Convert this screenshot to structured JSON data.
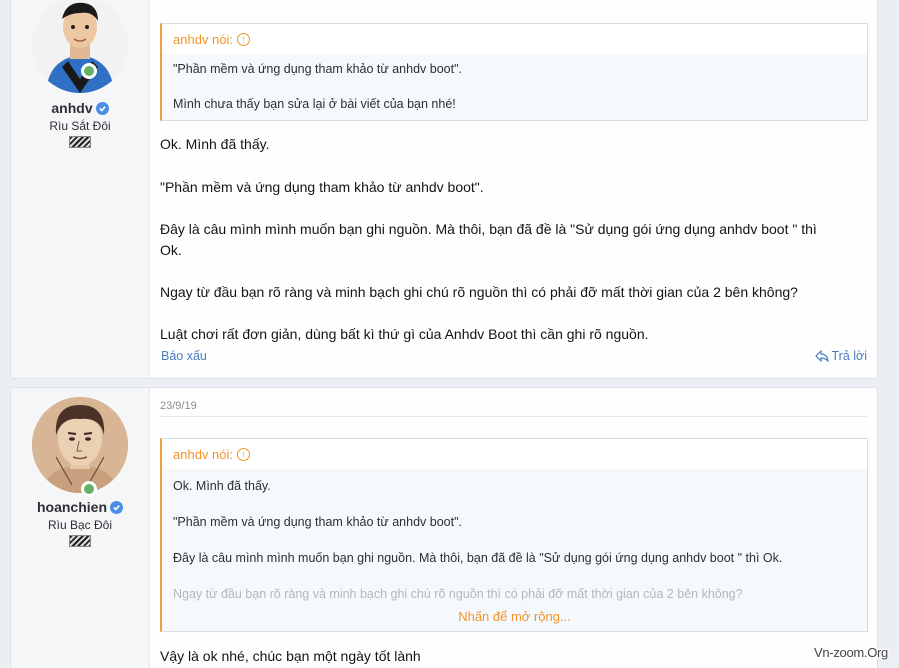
{
  "posts": [
    {
      "user": {
        "name": "anhdv",
        "title": "Rìu Sắt Đôi"
      },
      "quote": {
        "header": "anhdv nói:",
        "lines": [
          "\"Phần mềm và ứng dụng tham khảo từ anhdv boot\".",
          "Mình chưa thấy bạn sửa lại ở bài viết của bạn nhé!"
        ]
      },
      "message": [
        "Ok. Mình đã thấy.",
        "\"Phần mềm và ứng dụng tham khảo từ anhdv boot\".",
        "Đây là câu mình mình muốn bạn ghi nguồn. Mà thôi, bạn đã đề là \"Sử dụng gói ứng dụng anhdv boot \" thì",
        "Ok.",
        "Ngay từ đầu bạn rõ ràng và minh bạch ghi chú rõ nguồn thì có phải đỡ mất thời gian của 2 bên không?",
        "Luật chơi rất đơn giản, dùng bất kì thứ gì của Anhdv Boot thì cần ghi rõ nguồn."
      ],
      "report_label": "Báo xấu",
      "reply_label": "Trả lời"
    },
    {
      "date": "23/9/19",
      "user": {
        "name": "hoanchien",
        "title": "Rìu Bạc Đôi"
      },
      "quote": {
        "header": "anhdv nói:",
        "lines": [
          "Ok. Mình đã thấy.",
          "\"Phần mềm và ứng dụng tham khảo từ anhdv boot\".",
          "Đây là câu mình mình muốn bạn ghi nguồn. Mà thôi, bạn đã đề là \"Sử dụng gói ứng dụng anhdv boot \" thì Ok.",
          "Ngay từ đầu bạn rõ ràng và minh bạch ghi chú rõ nguồn thì có phải đỡ mất thời gian của 2 bên không?"
        ],
        "expand_label": "Nhấn để mở rộng..."
      },
      "message": [
        "Vậy là ok nhé, chúc bạn một ngày tốt lành"
      ]
    }
  ],
  "watermark": "Vn-zoom.Org",
  "colors": {
    "accent": "#f0942a",
    "link": "#4a7fbd",
    "online": "#63b265",
    "verified": "#4b8ee6"
  }
}
